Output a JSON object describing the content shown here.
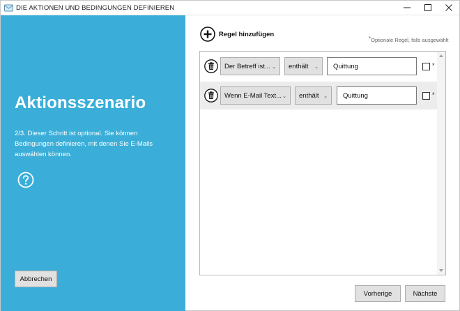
{
  "window": {
    "title": "DIE AKTIONEN UND BEDINGUNGEN DEFINIEREN",
    "icons": {
      "app": "app-icon",
      "minimize": "minimize-icon",
      "maximize": "maximize-icon",
      "close": "close-icon"
    }
  },
  "left": {
    "heading": "Aktionsszenario",
    "description": "2/3. Dieser Schritt ist optional. Sie können Bedingungen definieren, mit denen Sie E-Mails auswählen können.",
    "help_icon": "question-circle-icon",
    "cancel_label": "Abbrechen",
    "panel_color": "#3aaed8"
  },
  "rules": {
    "add_label": "Regel hinzufügen",
    "add_icon": "plus-circle-icon",
    "optional_star": "*",
    "optional_note": "Optionale Regel, falls ausgewählt",
    "items": [
      {
        "field": "Der Betreff ist...",
        "operator": "enthält",
        "value": "Quittung",
        "optional_checked": false,
        "star": "*"
      },
      {
        "field": "Wenn E-Mail Text...",
        "operator": "enthält",
        "value": "Quittung",
        "optional_checked": false,
        "star": "*"
      }
    ]
  },
  "footer": {
    "prev_label": "Vorherige",
    "next_label": "Nächste"
  }
}
